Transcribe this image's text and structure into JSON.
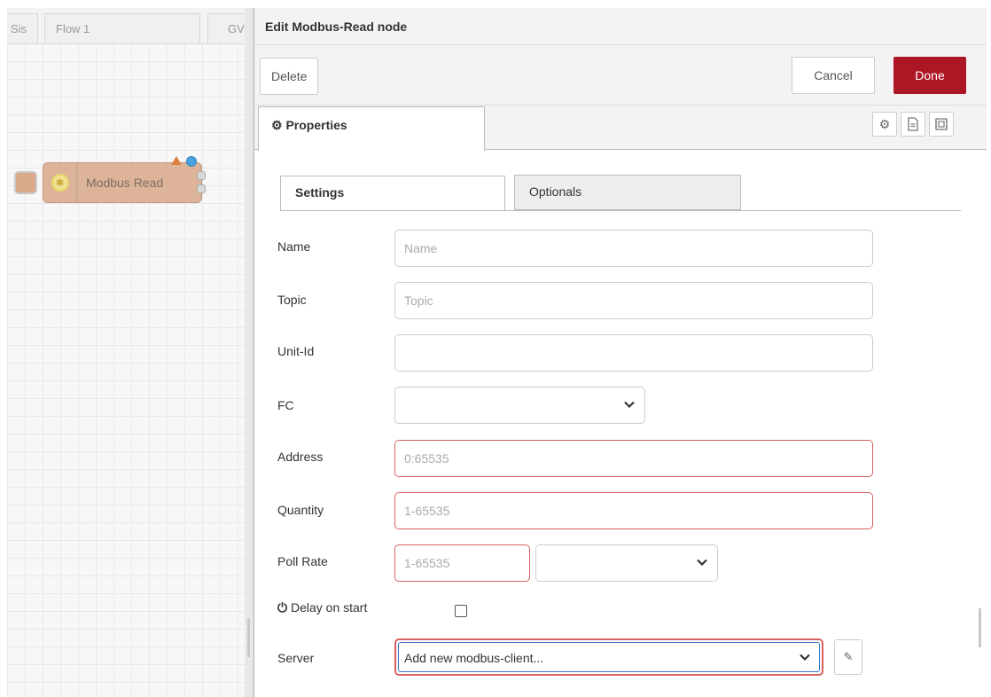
{
  "workspace": {
    "tabs": [
      {
        "label": "Sis"
      },
      {
        "label": "Flow 1"
      },
      {
        "label": "GV"
      }
    ],
    "node": {
      "label": "Modbus Read",
      "icon": "gear-icon",
      "color": "#d9a98a"
    }
  },
  "editor": {
    "title": "Edit Modbus-Read node",
    "delete_label": "Delete",
    "cancel_label": "Cancel",
    "done_label": "Done",
    "properties_tab": "Properties",
    "icons": [
      "gear-icon",
      "description-icon",
      "appearance-icon"
    ],
    "tabs": [
      {
        "label": "Settings",
        "active": true
      },
      {
        "label": "Optionals",
        "active": false
      }
    ],
    "fields": {
      "name": {
        "label": "Name",
        "placeholder": "Name",
        "value": ""
      },
      "topic": {
        "label": "Topic",
        "placeholder": "Topic",
        "value": ""
      },
      "unit_id": {
        "label": "Unit-Id",
        "placeholder": "",
        "value": ""
      },
      "fc": {
        "label": "FC",
        "value": ""
      },
      "address": {
        "label": "Address",
        "placeholder": "0:65535",
        "value": ""
      },
      "quantity": {
        "label": "Quantity",
        "placeholder": "1-65535",
        "value": ""
      },
      "poll_rate": {
        "label": "Poll Rate",
        "placeholder": "1-65535",
        "value": "",
        "unit": ""
      },
      "delay_on_start": {
        "label": "Delay on start",
        "checked": false
      },
      "server": {
        "label": "Server",
        "value": "Add new modbus-client..."
      }
    },
    "colors": {
      "done_button": "#ad1625",
      "invalid_border": "#d6615f"
    }
  }
}
